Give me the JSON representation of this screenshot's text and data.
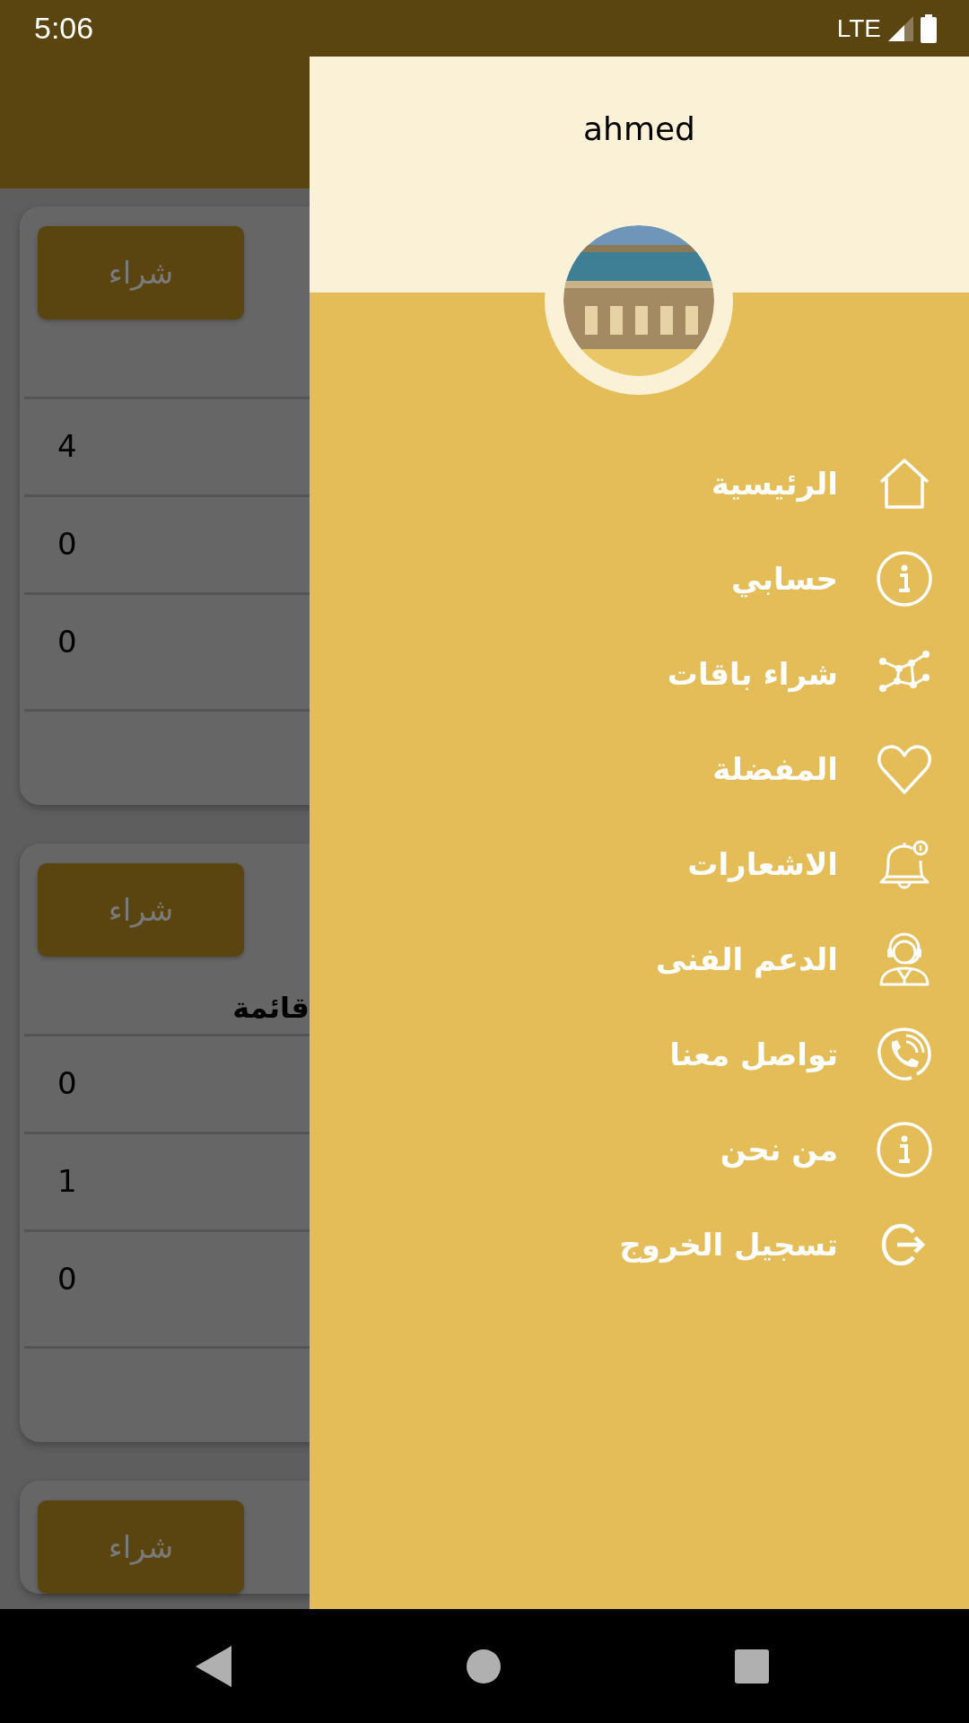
{
  "status_bar": {
    "time": "5:06",
    "network": "LTE"
  },
  "cards": [
    {
      "button": "شراء",
      "values": [
        "4",
        "0",
        "0"
      ]
    },
    {
      "button": "شراء",
      "title": "قائمة",
      "values": [
        "0",
        "1",
        "0"
      ]
    },
    {
      "button": "شراء"
    }
  ],
  "drawer": {
    "user_name": "ahmed",
    "menu": [
      {
        "label": "الرئيسية",
        "kind": "home"
      },
      {
        "label": "حسابي",
        "kind": "info"
      },
      {
        "label": "شراء باقات",
        "kind": "network"
      },
      {
        "label": "المفضلة",
        "kind": "heart"
      },
      {
        "label": "الاشعارات",
        "kind": "bell"
      },
      {
        "label": "الدعم الفنى",
        "kind": "support"
      },
      {
        "label": "تواصل معنا",
        "kind": "phone"
      },
      {
        "label": "من نحن",
        "kind": "info"
      },
      {
        "label": "تسجيل الخروج",
        "kind": "logout"
      }
    ]
  }
}
